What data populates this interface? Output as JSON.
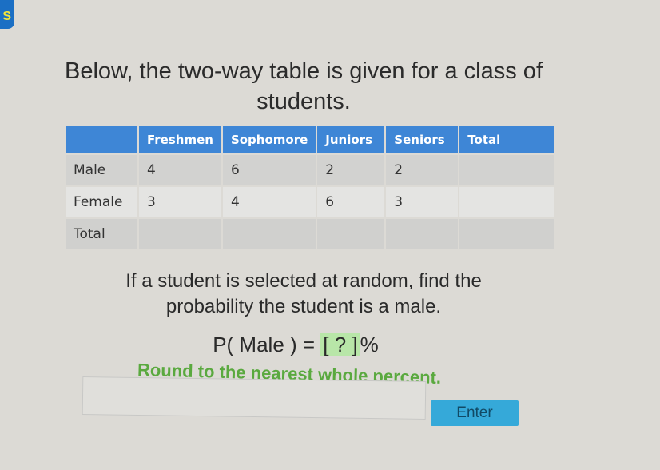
{
  "logo_text": "S",
  "title": "Below, the two-way table is given for a class of students.",
  "table": {
    "headers": [
      "",
      "Freshmen",
      "Sophomore",
      "Juniors",
      "Seniors",
      "Total"
    ],
    "rows": [
      [
        "Male",
        "4",
        "6",
        "2",
        "2",
        ""
      ],
      [
        "Female",
        "3",
        "4",
        "6",
        "3",
        ""
      ],
      [
        "Total",
        "",
        "",
        "",
        "",
        ""
      ]
    ]
  },
  "question": "If a student is selected at random, find the probability the student is a male.",
  "equation": {
    "prefix": "P( Male ) = ",
    "placeholder": "[ ? ]",
    "suffix": "%"
  },
  "hint": "Round to the nearest whole percent.",
  "answer_value": "",
  "enter_label": "Enter",
  "colors": {
    "header": "#3e86d6",
    "hint": "#5aa93f",
    "enter": "#35a9d9",
    "placeholder": "#b8e6a8"
  }
}
